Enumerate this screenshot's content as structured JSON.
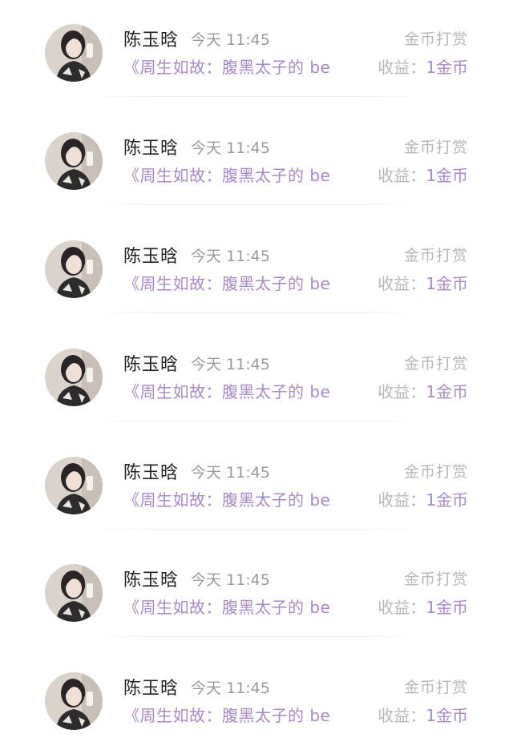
{
  "colors": {
    "accent": "#a98ac9",
    "name": "#222222",
    "meta": "#9a9a9a",
    "muted": "#b8b8b8"
  },
  "items": [
    {
      "name": "陈玉晗",
      "time": "今天 11:45",
      "type": "金币打赏",
      "book": "《周生如故：腹黑太子的 be",
      "income_label": "收益：",
      "income_value": "1金币"
    },
    {
      "name": "陈玉晗",
      "time": "今天 11:45",
      "type": "金币打赏",
      "book": "《周生如故：腹黑太子的 be",
      "income_label": "收益：",
      "income_value": "1金币"
    },
    {
      "name": "陈玉晗",
      "time": "今天 11:45",
      "type": "金币打赏",
      "book": "《周生如故：腹黑太子的 be",
      "income_label": "收益：",
      "income_value": "1金币"
    },
    {
      "name": "陈玉晗",
      "time": "今天 11:45",
      "type": "金币打赏",
      "book": "《周生如故：腹黑太子的 be",
      "income_label": "收益：",
      "income_value": "1金币"
    },
    {
      "name": "陈玉晗",
      "time": "今天 11:45",
      "type": "金币打赏",
      "book": "《周生如故：腹黑太子的 be",
      "income_label": "收益：",
      "income_value": "1金币"
    },
    {
      "name": "陈玉晗",
      "time": "今天 11:45",
      "type": "金币打赏",
      "book": "《周生如故：腹黑太子的 be",
      "income_label": "收益：",
      "income_value": "1金币"
    },
    {
      "name": "陈玉晗",
      "time": "今天 11:45",
      "type": "金币打赏",
      "book": "《周生如故：腹黑太子的 be",
      "income_label": "收益：",
      "income_value": "1金币"
    }
  ]
}
